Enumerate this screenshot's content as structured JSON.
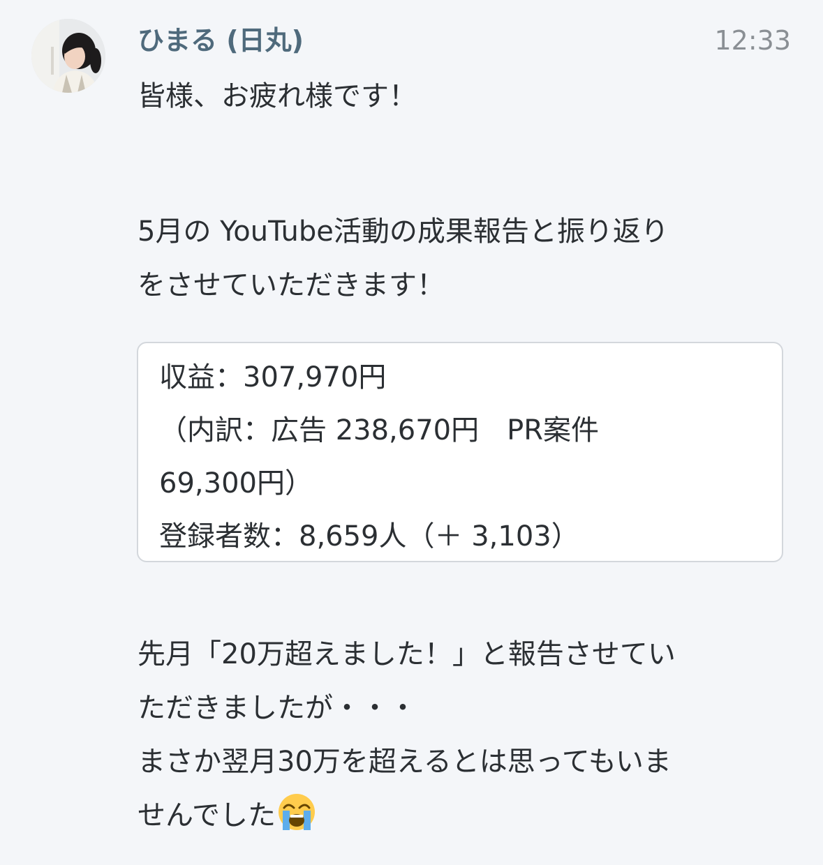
{
  "message": {
    "sender": "ひまる (日丸)",
    "time": "12:33",
    "avatar_icon": "profile-photo",
    "lines_top": [
      "皆様、お疲れ様です！",
      "",
      "5月の YouTube活動の成果報告と振り返り",
      "をさせていただきます！"
    ],
    "card_lines": [
      "収益：307,970円",
      "（内訳：広告 238,670円　PR案件",
      "69,300円）",
      "登録者数：8,659人（＋ 3,103）"
    ],
    "lines_bottom": [
      "先月「20万超えました！」と報告させてい",
      "ただきましたが・・・",
      "まさか翌月30万を超えるとは思ってもいま",
      "せんでした"
    ],
    "emoji_icon": "loudly-crying-face-icon"
  },
  "colors": {
    "background": "#f4f6f9",
    "sender": "#4f6a7c",
    "time": "#8a8f94",
    "text": "#2b2f33",
    "card_border": "#d3d7dc"
  }
}
